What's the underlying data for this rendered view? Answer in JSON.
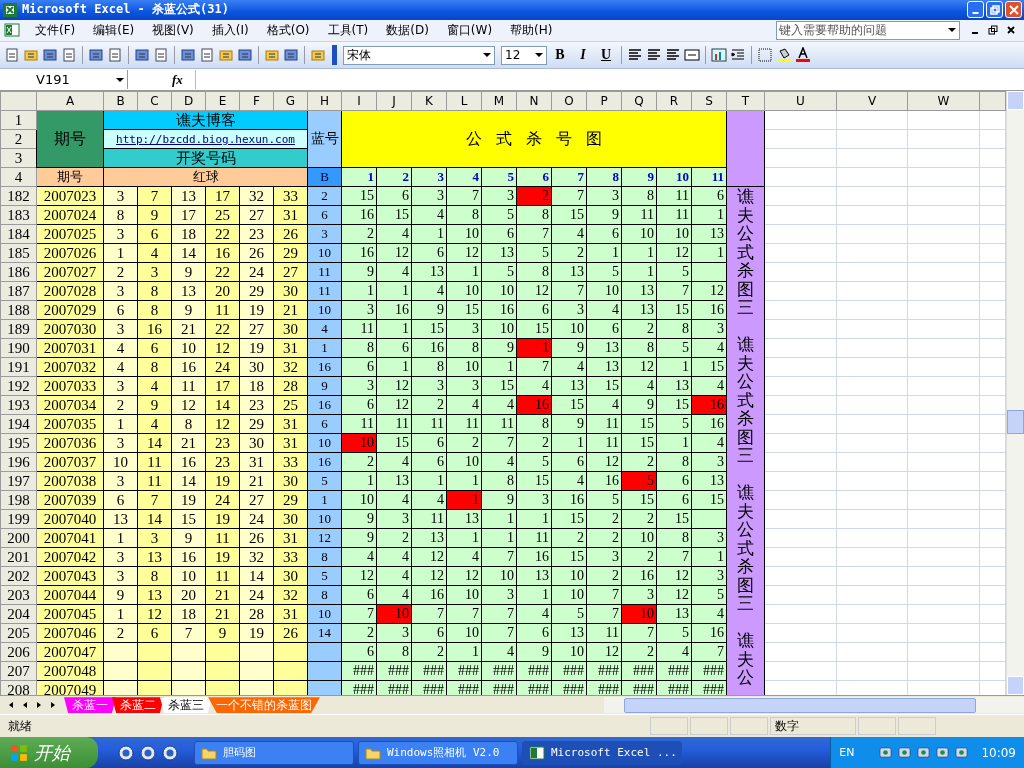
{
  "window": {
    "title": "Microsoft Excel - 杀蓝公式(31)"
  },
  "menu": [
    "文件(F)",
    "编辑(E)",
    "视图(V)",
    "插入(I)",
    "格式(O)",
    "工具(T)",
    "数据(D)",
    "窗口(W)",
    "帮助(H)"
  ],
  "help_search": {
    "placeholder": "键入需要帮助的问题"
  },
  "format_toolbar": {
    "font": "宋体",
    "size": "12",
    "bold": "B",
    "italic": "I",
    "underline": "U"
  },
  "formula_bar": {
    "name_box": "V191",
    "fx": "fx"
  },
  "columns": [
    "A",
    "B",
    "C",
    "D",
    "E",
    "F",
    "G",
    "H",
    "I",
    "J",
    "K",
    "L",
    "M",
    "N",
    "O",
    "P",
    "Q",
    "R",
    "S",
    "T",
    "U",
    "V",
    "W"
  ],
  "header": {
    "issue_title": "期号",
    "blog": "谯夫博客",
    "link": "http://bzcdd.biog.hexun.com",
    "draw_title": "开奖号码",
    "blue_title": "蓝号",
    "formula_title": "公 式 杀 号 图",
    "issue_label": "期号",
    "red_label": "红球",
    "blue_label": "B",
    "kill_numbers": [
      "1",
      "2",
      "3",
      "4",
      "5",
      "6",
      "7",
      "8",
      "9",
      "10",
      "11"
    ],
    "row_numbers": [
      "1",
      "2",
      "3",
      "4"
    ]
  },
  "rows": [
    {
      "row": "182",
      "issue": "2007023",
      "red": [
        "3",
        "7",
        "13",
        "17",
        "32",
        "33"
      ],
      "blue": "2",
      "kill": [
        "15",
        "6",
        "3",
        "7",
        "3",
        "2",
        "7",
        "3",
        "8",
        "11",
        "6"
      ],
      "hit": [
        false,
        false,
        false,
        false,
        false,
        true,
        false,
        false,
        false,
        false,
        false
      ]
    },
    {
      "row": "183",
      "issue": "2007024",
      "red": [
        "8",
        "9",
        "17",
        "25",
        "27",
        "31"
      ],
      "blue": "6",
      "kill": [
        "16",
        "15",
        "4",
        "8",
        "5",
        "8",
        "15",
        "9",
        "11",
        "11",
        "1"
      ],
      "hit": [
        false,
        false,
        false,
        false,
        false,
        false,
        false,
        false,
        false,
        false,
        false
      ]
    },
    {
      "row": "184",
      "issue": "2007025",
      "red": [
        "3",
        "6",
        "18",
        "22",
        "23",
        "26"
      ],
      "blue": "3",
      "kill": [
        "2",
        "4",
        "1",
        "10",
        "6",
        "7",
        "4",
        "6",
        "10",
        "10",
        "13"
      ],
      "hit": [
        false,
        false,
        false,
        false,
        false,
        false,
        false,
        false,
        false,
        false,
        false
      ]
    },
    {
      "row": "185",
      "issue": "2007026",
      "red": [
        "1",
        "4",
        "14",
        "16",
        "26",
        "29"
      ],
      "blue": "10",
      "kill": [
        "16",
        "12",
        "6",
        "12",
        "13",
        "5",
        "2",
        "1",
        "1",
        "12",
        "1"
      ],
      "hit": [
        false,
        false,
        false,
        false,
        false,
        false,
        false,
        false,
        false,
        false,
        false
      ]
    },
    {
      "row": "186",
      "issue": "2007027",
      "red": [
        "2",
        "3",
        "9",
        "22",
        "24",
        "27"
      ],
      "blue": "11",
      "kill": [
        "9",
        "4",
        "13",
        "1",
        "5",
        "8",
        "13",
        "5",
        "1",
        "5"
      ],
      "hit": [
        false,
        false,
        false,
        false,
        false,
        false,
        false,
        false,
        false,
        false,
        false
      ]
    },
    {
      "row": "187",
      "issue": "2007028",
      "red": [
        "3",
        "8",
        "13",
        "20",
        "29",
        "30"
      ],
      "blue": "11",
      "kill": [
        "1",
        "1",
        "4",
        "10",
        "10",
        "12",
        "7",
        "10",
        "13",
        "7",
        "12"
      ],
      "hit": [
        false,
        false,
        false,
        false,
        false,
        false,
        false,
        false,
        false,
        false,
        false
      ]
    },
    {
      "row": "188",
      "issue": "2007029",
      "red": [
        "6",
        "8",
        "9",
        "11",
        "19",
        "21"
      ],
      "blue": "10",
      "kill": [
        "3",
        "16",
        "9",
        "15",
        "16",
        "6",
        "3",
        "4",
        "13",
        "15",
        "16"
      ],
      "hit": [
        false,
        false,
        false,
        false,
        false,
        false,
        false,
        false,
        false,
        false,
        false
      ]
    },
    {
      "row": "189",
      "issue": "2007030",
      "red": [
        "3",
        "16",
        "21",
        "22",
        "27",
        "30"
      ],
      "blue": "4",
      "kill": [
        "11",
        "1",
        "15",
        "3",
        "10",
        "15",
        "10",
        "6",
        "2",
        "8",
        "3"
      ],
      "hit": [
        false,
        false,
        false,
        false,
        false,
        false,
        false,
        false,
        false,
        false,
        false
      ]
    },
    {
      "row": "190",
      "issue": "2007031",
      "red": [
        "4",
        "6",
        "10",
        "12",
        "19",
        "31"
      ],
      "blue": "1",
      "kill": [
        "8",
        "6",
        "16",
        "8",
        "9",
        "1",
        "9",
        "13",
        "8",
        "5",
        "4"
      ],
      "hit": [
        false,
        false,
        false,
        false,
        false,
        true,
        false,
        false,
        false,
        false,
        false
      ]
    },
    {
      "row": "191",
      "issue": "2007032",
      "red": [
        "4",
        "8",
        "16",
        "24",
        "30",
        "32"
      ],
      "blue": "16",
      "kill": [
        "6",
        "1",
        "8",
        "10",
        "1",
        "7",
        "4",
        "13",
        "12",
        "1",
        "15"
      ],
      "hit": [
        false,
        false,
        false,
        false,
        false,
        false,
        false,
        false,
        false,
        false,
        false
      ]
    },
    {
      "row": "192",
      "issue": "2007033",
      "red": [
        "3",
        "4",
        "11",
        "17",
        "18",
        "28"
      ],
      "blue": "9",
      "kill": [
        "3",
        "12",
        "3",
        "3",
        "15",
        "4",
        "13",
        "15",
        "4",
        "13",
        "4"
      ],
      "hit": [
        false,
        false,
        false,
        false,
        false,
        false,
        false,
        false,
        false,
        false,
        false
      ]
    },
    {
      "row": "193",
      "issue": "2007034",
      "red": [
        "2",
        "9",
        "12",
        "14",
        "23",
        "25"
      ],
      "blue": "16",
      "kill": [
        "6",
        "12",
        "2",
        "4",
        "4",
        "16",
        "15",
        "4",
        "9",
        "15",
        "16"
      ],
      "hit": [
        false,
        false,
        false,
        false,
        false,
        true,
        false,
        false,
        false,
        false,
        true
      ]
    },
    {
      "row": "194",
      "issue": "2007035",
      "red": [
        "1",
        "4",
        "8",
        "12",
        "29",
        "31"
      ],
      "blue": "6",
      "kill": [
        "11",
        "11",
        "11",
        "11",
        "11",
        "8",
        "9",
        "11",
        "15",
        "5",
        "16"
      ],
      "hit": [
        false,
        false,
        false,
        false,
        false,
        false,
        false,
        false,
        false,
        false,
        false
      ]
    },
    {
      "row": "195",
      "issue": "2007036",
      "red": [
        "3",
        "14",
        "21",
        "23",
        "30",
        "31"
      ],
      "blue": "10",
      "kill": [
        "10",
        "15",
        "6",
        "2",
        "7",
        "2",
        "1",
        "11",
        "15",
        "1",
        "4"
      ],
      "hit": [
        true,
        false,
        false,
        false,
        false,
        false,
        false,
        false,
        false,
        false,
        false
      ]
    },
    {
      "row": "196",
      "issue": "2007037",
      "red": [
        "10",
        "11",
        "16",
        "23",
        "31",
        "33"
      ],
      "blue": "16",
      "kill": [
        "2",
        "4",
        "6",
        "10",
        "4",
        "5",
        "6",
        "12",
        "2",
        "8",
        "3"
      ],
      "hit": [
        false,
        false,
        false,
        false,
        false,
        false,
        false,
        false,
        false,
        false,
        false
      ]
    },
    {
      "row": "197",
      "issue": "2007038",
      "red": [
        "3",
        "11",
        "14",
        "19",
        "21",
        "30"
      ],
      "blue": "5",
      "kill": [
        "1",
        "13",
        "1",
        "1",
        "8",
        "15",
        "4",
        "16",
        "5",
        "6",
        "13"
      ],
      "hit": [
        false,
        false,
        false,
        false,
        false,
        false,
        false,
        false,
        true,
        false,
        false
      ]
    },
    {
      "row": "198",
      "issue": "2007039",
      "red": [
        "6",
        "7",
        "19",
        "24",
        "27",
        "29"
      ],
      "blue": "1",
      "kill": [
        "10",
        "4",
        "4",
        "1",
        "9",
        "3",
        "16",
        "5",
        "15",
        "6",
        "15"
      ],
      "hit": [
        false,
        false,
        false,
        true,
        false,
        false,
        false,
        false,
        false,
        false,
        false
      ]
    },
    {
      "row": "199",
      "issue": "2007040",
      "red": [
        "13",
        "14",
        "15",
        "19",
        "24",
        "30"
      ],
      "blue": "10",
      "kill": [
        "9",
        "3",
        "11",
        "13",
        "1",
        "1",
        "15",
        "2",
        "2",
        "15"
      ],
      "hit": [
        false,
        false,
        false,
        false,
        false,
        false,
        false,
        false,
        false,
        false,
        false
      ]
    },
    {
      "row": "200",
      "issue": "2007041",
      "red": [
        "1",
        "3",
        "9",
        "11",
        "26",
        "31"
      ],
      "blue": "12",
      "kill": [
        "9",
        "2",
        "13",
        "1",
        "1",
        "11",
        "2",
        "2",
        "10",
        "8",
        "3"
      ],
      "hit": [
        false,
        false,
        false,
        false,
        false,
        false,
        false,
        false,
        false,
        false,
        false
      ]
    },
    {
      "row": "201",
      "issue": "2007042",
      "red": [
        "3",
        "13",
        "16",
        "19",
        "32",
        "33"
      ],
      "blue": "8",
      "kill": [
        "4",
        "4",
        "12",
        "4",
        "7",
        "16",
        "15",
        "3",
        "2",
        "7",
        "1"
      ],
      "hit": [
        false,
        false,
        false,
        false,
        false,
        false,
        false,
        false,
        false,
        false,
        false
      ]
    },
    {
      "row": "202",
      "issue": "2007043",
      "red": [
        "3",
        "8",
        "10",
        "11",
        "14",
        "30"
      ],
      "blue": "5",
      "kill": [
        "12",
        "4",
        "12",
        "12",
        "10",
        "13",
        "10",
        "2",
        "16",
        "12",
        "3"
      ],
      "hit": [
        false,
        false,
        false,
        false,
        false,
        false,
        false,
        false,
        false,
        false,
        false
      ]
    },
    {
      "row": "203",
      "issue": "2007044",
      "red": [
        "9",
        "13",
        "20",
        "21",
        "24",
        "32"
      ],
      "blue": "8",
      "kill": [
        "6",
        "4",
        "16",
        "10",
        "3",
        "1",
        "10",
        "7",
        "3",
        "12",
        "5"
      ],
      "hit": [
        false,
        false,
        false,
        false,
        false,
        false,
        false,
        false,
        false,
        false,
        false
      ]
    },
    {
      "row": "204",
      "issue": "2007045",
      "red": [
        "1",
        "12",
        "18",
        "21",
        "28",
        "31"
      ],
      "blue": "10",
      "kill": [
        "7",
        "10",
        "7",
        "7",
        "7",
        "4",
        "5",
        "7",
        "10",
        "13",
        "4"
      ],
      "hit": [
        false,
        true,
        false,
        false,
        false,
        false,
        false,
        false,
        true,
        false,
        false
      ]
    },
    {
      "row": "205",
      "issue": "2007046",
      "red": [
        "2",
        "6",
        "7",
        "9",
        "19",
        "26"
      ],
      "blue": "14",
      "kill": [
        "2",
        "3",
        "6",
        "10",
        "7",
        "6",
        "13",
        "11",
        "7",
        "5",
        "16"
      ],
      "hit": [
        false,
        false,
        false,
        false,
        false,
        false,
        false,
        false,
        false,
        false,
        false
      ]
    },
    {
      "row": "206",
      "issue": "2007047",
      "kill": [
        "6",
        "8",
        "2",
        "1",
        "4",
        "9",
        "10",
        "12",
        "2",
        "4",
        "7"
      ],
      "hit": [
        false,
        false,
        false,
        false,
        false,
        false,
        false,
        false,
        false,
        false,
        false
      ]
    },
    {
      "row": "207",
      "issue": "2007048",
      "kill": [
        "###",
        "###",
        "###",
        "###",
        "###",
        "###",
        "###",
        "###",
        "###",
        "###",
        "###"
      ],
      "hit": [
        false,
        false,
        false,
        false,
        false,
        false,
        false,
        false,
        false,
        false,
        false
      ]
    },
    {
      "row": "208",
      "issue": "2007049",
      "kill": [
        "###",
        "###",
        "###",
        "###",
        "###",
        "###",
        "###",
        "###",
        "###",
        "###",
        "###"
      ],
      "hit": [
        false,
        false,
        false,
        false,
        false,
        false,
        false,
        false,
        false,
        false,
        false
      ]
    }
  ],
  "side_text": [
    "谯夫公式杀图三",
    "谯夫公式杀图三",
    "谯夫公式杀图三",
    "谯夫公"
  ],
  "sheet_tabs": [
    {
      "label": "杀蓝一",
      "color": "#ff00ff",
      "selected": false
    },
    {
      "label": "杀蓝二",
      "color": "#ff0000",
      "selected": false
    },
    {
      "label": "杀蓝三",
      "color": "#ffffff",
      "selected": true
    },
    {
      "label": "一个不错的杀蓝图",
      "color": "#ff6600",
      "selected": false
    }
  ],
  "status_bar": {
    "state": "就绪",
    "mode": "数字"
  },
  "taskbar": {
    "start": "开始",
    "tasks": [
      {
        "label": "胆码图",
        "kind": "folder",
        "selected": false
      },
      {
        "label": "Windows照相机 V2.0",
        "kind": "folder",
        "selected": false
      },
      {
        "label": "Microsoft Excel ...",
        "kind": "excel",
        "selected": true
      }
    ],
    "language": "EN",
    "time": "10:09"
  }
}
